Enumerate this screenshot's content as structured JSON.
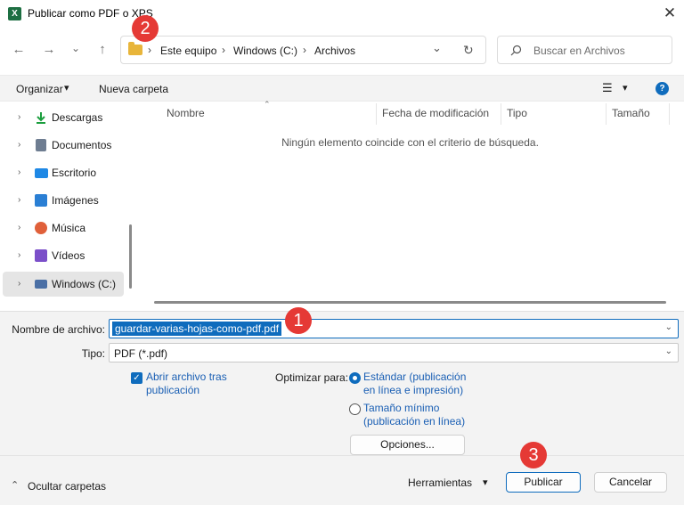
{
  "window": {
    "title": "Publicar como PDF o XPS",
    "app_icon_letter": "X",
    "close_glyph": "✕"
  },
  "nav_buttons": {
    "back": "←",
    "forward": "→",
    "recent": "⌄",
    "up": "↑"
  },
  "address_bar": {
    "breadcrumb": [
      "Este equipo",
      "Windows (C:)",
      "Archivos"
    ],
    "separator": "›",
    "dropdown": "⌄",
    "refresh": "↻"
  },
  "search": {
    "placeholder": "Buscar en Archivos",
    "icon": "search-icon"
  },
  "toolbar": {
    "organize_label": "Organizar",
    "organize_caret": "▾",
    "new_folder_label": "Nueva carpeta",
    "view_glyph": "☰",
    "view_caret": "▾",
    "help_glyph": "?"
  },
  "sidebar": {
    "items": [
      {
        "label": "Descargas",
        "icon": "download-icon",
        "color": "#1b9e3e"
      },
      {
        "label": "Documentos",
        "icon": "document-icon",
        "color": "#6e7d91"
      },
      {
        "label": "Escritorio",
        "icon": "desktop-icon",
        "color": "#1e88e5"
      },
      {
        "label": "Imágenes",
        "icon": "image-icon",
        "color": "#2a7fd4"
      },
      {
        "label": "Música",
        "icon": "music-icon",
        "color": "#e0603a"
      },
      {
        "label": "Vídeos",
        "icon": "video-icon",
        "color": "#7b4fc9"
      },
      {
        "label": "Windows (C:)",
        "icon": "drive-icon",
        "color": "#4a6fa5",
        "selected": true
      }
    ],
    "chevron": "›"
  },
  "file_list": {
    "columns": [
      "Nombre",
      "Fecha de modificación",
      "Tipo",
      "Tamaño"
    ],
    "sort_indicator": "⌃",
    "empty_message": "Ningún elemento coincide con el criterio de búsqueda."
  },
  "form": {
    "filename_label": "Nombre de archivo:",
    "filename_value": "guardar-varias-hojas-como-pdf.pdf",
    "type_label": "Tipo:",
    "type_value": "PDF (*.pdf)",
    "open_after_line1": "Abrir archivo tras",
    "open_after_line2": "publicación",
    "open_after_checked": true,
    "optimize_label": "Optimizar para:",
    "opt_standard_line1": "Estándar (publicación",
    "opt_standard_line2": "en línea e impresión)",
    "opt_minimum_line1": "Tamaño mínimo",
    "opt_minimum_line2": "(publicación en línea)",
    "selected_option": "standard",
    "options_button": "Opciones...",
    "caret": "⌄"
  },
  "footer": {
    "hide_folders_caret": "⌃",
    "hide_folders_label": "Ocultar carpetas",
    "tools_label": "Herramientas",
    "tools_caret": "▾",
    "publish_label": "Publicar",
    "cancel_label": "Cancelar"
  },
  "annotations": {
    "badge_1": "1",
    "badge_2": "2",
    "badge_3": "3",
    "badge_color": "#e53935"
  },
  "colors": {
    "accent": "#0f6cbd",
    "excel_green": "#1d6f42",
    "folder_yellow": "#e8b53a"
  }
}
